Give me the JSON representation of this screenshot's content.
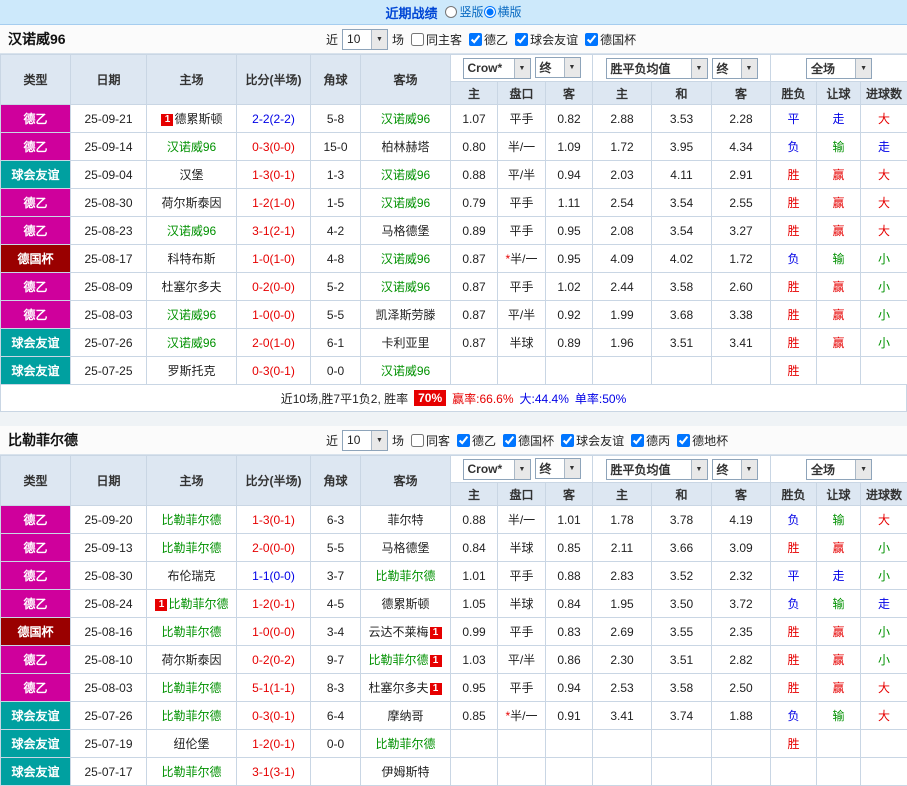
{
  "topbar": {
    "title": "近期战绩",
    "options": [
      {
        "label": "竖版",
        "selected": false
      },
      {
        "label": "横版",
        "selected": true
      }
    ]
  },
  "palette": {
    "league_colors": {
      "德乙": "#cf009c",
      "球会友谊": "#00a0a0",
      "德国杯": "#9a0000"
    },
    "result_colors": {
      "red": "#e60000",
      "blue": "#0000e6",
      "green": "#009100"
    },
    "score_colors": {
      "red": "#e60000",
      "blue": "#0000e6"
    },
    "team_highlight": "#009100"
  },
  "table_header": {
    "left": [
      "类型",
      "日期",
      "主场",
      "比分(半场)",
      "角球",
      "客场"
    ],
    "asia_select": "Crow*",
    "asia_final": "终",
    "asia_sub": [
      "主",
      "盘口",
      "客"
    ],
    "europe_select": "胜平负均值",
    "europe_final": "终",
    "europe_sub": [
      "主",
      "和",
      "客"
    ],
    "full_select": "全场",
    "result_sub": [
      "胜负",
      "让球",
      "进球数"
    ]
  },
  "sections": [
    {
      "team": "汉诺威96",
      "filter": {
        "prefix": "近",
        "count": "10",
        "suffix": "场",
        "checkboxes": [
          {
            "label": "同主客",
            "checked": false
          },
          {
            "label": "德乙",
            "checked": true
          },
          {
            "label": "球会友谊",
            "checked": true
          },
          {
            "label": "德国杯",
            "checked": true
          }
        ]
      },
      "rows": [
        {
          "league": "德乙",
          "date": "25-09-21",
          "home": "德累斯顿",
          "home_green": false,
          "home_badge": "1",
          "away": "汉诺威96",
          "away_green": true,
          "score": "2-2(2-2)",
          "score_color": "blue",
          "corner": "5-8",
          "asia": [
            "1.07",
            "平手",
            "0.82"
          ],
          "asia_star": false,
          "europe": [
            "2.88",
            "3.53",
            "2.28"
          ],
          "results": [
            [
              "平",
              "blue"
            ],
            [
              "走",
              "blue"
            ],
            [
              "大",
              "red"
            ]
          ]
        },
        {
          "league": "德乙",
          "date": "25-09-14",
          "home": "汉诺威96",
          "home_green": true,
          "away": "柏林赫塔",
          "away_green": false,
          "score": "0-3(0-0)",
          "score_color": "red",
          "corner": "15-0",
          "asia": [
            "0.80",
            "半/一",
            "1.09"
          ],
          "asia_star": false,
          "europe": [
            "1.72",
            "3.95",
            "4.34"
          ],
          "results": [
            [
              "负",
              "blue"
            ],
            [
              "输",
              "green"
            ],
            [
              "走",
              "blue"
            ]
          ]
        },
        {
          "league": "球会友谊",
          "date": "25-09-04",
          "home": "汉堡",
          "home_green": false,
          "away": "汉诺威96",
          "away_green": true,
          "score": "1-3(0-1)",
          "score_color": "red",
          "corner": "1-3",
          "asia": [
            "0.88",
            "平/半",
            "0.94"
          ],
          "asia_star": false,
          "europe": [
            "2.03",
            "4.11",
            "2.91"
          ],
          "results": [
            [
              "胜",
              "red"
            ],
            [
              "赢",
              "red"
            ],
            [
              "大",
              "red"
            ]
          ]
        },
        {
          "league": "德乙",
          "date": "25-08-30",
          "home": "荷尔斯泰因",
          "home_green": false,
          "away": "汉诺威96",
          "away_green": true,
          "score": "1-2(1-0)",
          "score_color": "red",
          "corner": "1-5",
          "asia": [
            "0.79",
            "平手",
            "1.11"
          ],
          "asia_star": false,
          "europe": [
            "2.54",
            "3.54",
            "2.55"
          ],
          "results": [
            [
              "胜",
              "red"
            ],
            [
              "赢",
              "red"
            ],
            [
              "大",
              "red"
            ]
          ]
        },
        {
          "league": "德乙",
          "date": "25-08-23",
          "home": "汉诺威96",
          "home_green": true,
          "away": "马格德堡",
          "away_green": false,
          "score": "3-1(2-1)",
          "score_color": "red",
          "corner": "4-2",
          "asia": [
            "0.89",
            "平手",
            "0.95"
          ],
          "asia_star": false,
          "europe": [
            "2.08",
            "3.54",
            "3.27"
          ],
          "results": [
            [
              "胜",
              "red"
            ],
            [
              "赢",
              "red"
            ],
            [
              "大",
              "red"
            ]
          ]
        },
        {
          "league": "德国杯",
          "date": "25-08-17",
          "home": "科特布斯",
          "home_green": false,
          "away": "汉诺威96",
          "away_green": true,
          "score": "1-0(1-0)",
          "score_color": "red",
          "corner": "4-8",
          "asia": [
            "0.87",
            "半/一",
            "0.95"
          ],
          "asia_star": true,
          "europe": [
            "4.09",
            "4.02",
            "1.72"
          ],
          "results": [
            [
              "负",
              "blue"
            ],
            [
              "输",
              "green"
            ],
            [
              "小",
              "green"
            ]
          ]
        },
        {
          "league": "德乙",
          "date": "25-08-09",
          "home": "杜塞尔多夫",
          "home_green": false,
          "away": "汉诺威96",
          "away_green": true,
          "score": "0-2(0-0)",
          "score_color": "red",
          "corner": "5-2",
          "asia": [
            "0.87",
            "平手",
            "1.02"
          ],
          "asia_star": false,
          "europe": [
            "2.44",
            "3.58",
            "2.60"
          ],
          "results": [
            [
              "胜",
              "red"
            ],
            [
              "赢",
              "red"
            ],
            [
              "小",
              "green"
            ]
          ]
        },
        {
          "league": "德乙",
          "date": "25-08-03",
          "home": "汉诺威96",
          "home_green": true,
          "away": "凯泽斯劳滕",
          "away_green": false,
          "score": "1-0(0-0)",
          "score_color": "red",
          "corner": "5-5",
          "asia": [
            "0.87",
            "平/半",
            "0.92"
          ],
          "asia_star": false,
          "europe": [
            "1.99",
            "3.68",
            "3.38"
          ],
          "results": [
            [
              "胜",
              "red"
            ],
            [
              "赢",
              "red"
            ],
            [
              "小",
              "green"
            ]
          ]
        },
        {
          "league": "球会友谊",
          "date": "25-07-26",
          "home": "汉诺威96",
          "home_green": true,
          "away": "卡利亚里",
          "away_green": false,
          "score": "2-0(1-0)",
          "score_color": "red",
          "corner": "6-1",
          "asia": [
            "0.87",
            "半球",
            "0.89"
          ],
          "asia_star": false,
          "europe": [
            "1.96",
            "3.51",
            "3.41"
          ],
          "results": [
            [
              "胜",
              "red"
            ],
            [
              "赢",
              "red"
            ],
            [
              "小",
              "green"
            ]
          ]
        },
        {
          "league": "球会友谊",
          "date": "25-07-25",
          "home": "罗斯托克",
          "home_green": false,
          "away": "汉诺威96",
          "away_green": true,
          "score": "0-3(0-1)",
          "score_color": "red",
          "corner": "0-0",
          "asia": [
            "",
            "",
            ""
          ],
          "asia_star": false,
          "europe": [
            "",
            "",
            ""
          ],
          "results": [
            [
              "胜",
              "red"
            ],
            [
              "",
              ""
            ],
            [
              "",
              ""
            ]
          ]
        }
      ],
      "summary": {
        "prefix": "近10场,胜7平1负2, 胜率",
        "rate": "70%",
        "stats": [
          {
            "text": "赢率:66.6%",
            "color": "red"
          },
          {
            "text": "大:44.4%",
            "color": "blue"
          },
          {
            "text": "单率:50%",
            "color": "blue"
          }
        ]
      }
    },
    {
      "team": "比勒菲尔德",
      "filter": {
        "prefix": "近",
        "count": "10",
        "suffix": "场",
        "checkboxes": [
          {
            "label": "同客",
            "checked": false
          },
          {
            "label": "德乙",
            "checked": true
          },
          {
            "label": "德国杯",
            "checked": true
          },
          {
            "label": "球会友谊",
            "checked": true
          },
          {
            "label": "德丙",
            "checked": true
          },
          {
            "label": "德地杯",
            "checked": true
          }
        ]
      },
      "rows": [
        {
          "league": "德乙",
          "date": "25-09-20",
          "home": "比勒菲尔德",
          "home_green": true,
          "away": "菲尔特",
          "away_green": false,
          "score": "1-3(0-1)",
          "score_color": "red",
          "corner": "6-3",
          "asia": [
            "0.88",
            "半/一",
            "1.01"
          ],
          "asia_star": false,
          "europe": [
            "1.78",
            "3.78",
            "4.19"
          ],
          "results": [
            [
              "负",
              "blue"
            ],
            [
              "输",
              "green"
            ],
            [
              "大",
              "red"
            ]
          ]
        },
        {
          "league": "德乙",
          "date": "25-09-13",
          "home": "比勒菲尔德",
          "home_green": true,
          "away": "马格德堡",
          "away_green": false,
          "score": "2-0(0-0)",
          "score_color": "red",
          "corner": "5-5",
          "asia": [
            "0.84",
            "半球",
            "0.85"
          ],
          "asia_star": false,
          "europe": [
            "2.11",
            "3.66",
            "3.09"
          ],
          "results": [
            [
              "胜",
              "red"
            ],
            [
              "赢",
              "red"
            ],
            [
              "小",
              "green"
            ]
          ]
        },
        {
          "league": "德乙",
          "date": "25-08-30",
          "home": "布伦瑞克",
          "home_green": false,
          "away": "比勒菲尔德",
          "away_green": true,
          "score": "1-1(0-0)",
          "score_color": "blue",
          "corner": "3-7",
          "asia": [
            "1.01",
            "平手",
            "0.88"
          ],
          "asia_star": false,
          "europe": [
            "2.83",
            "3.52",
            "2.32"
          ],
          "results": [
            [
              "平",
              "blue"
            ],
            [
              "走",
              "blue"
            ],
            [
              "小",
              "green"
            ]
          ]
        },
        {
          "league": "德乙",
          "date": "25-08-24",
          "home": "比勒菲尔德",
          "home_green": true,
          "home_badge": "1",
          "away": "德累斯顿",
          "away_green": false,
          "score": "1-2(0-1)",
          "score_color": "red",
          "corner": "4-5",
          "asia": [
            "1.05",
            "半球",
            "0.84"
          ],
          "asia_star": false,
          "europe": [
            "1.95",
            "3.50",
            "3.72"
          ],
          "results": [
            [
              "负",
              "blue"
            ],
            [
              "输",
              "green"
            ],
            [
              "走",
              "blue"
            ]
          ]
        },
        {
          "league": "德国杯",
          "date": "25-08-16",
          "home": "比勒菲尔德",
          "home_green": true,
          "away": "云达不莱梅",
          "away_green": false,
          "away_badge": "1",
          "score": "1-0(0-0)",
          "score_color": "red",
          "corner": "3-4",
          "asia": [
            "0.99",
            "平手",
            "0.83"
          ],
          "asia_star": false,
          "europe": [
            "2.69",
            "3.55",
            "2.35"
          ],
          "results": [
            [
              "胜",
              "red"
            ],
            [
              "赢",
              "red"
            ],
            [
              "小",
              "green"
            ]
          ]
        },
        {
          "league": "德乙",
          "date": "25-08-10",
          "home": "荷尔斯泰因",
          "home_green": false,
          "away": "比勒菲尔德",
          "away_green": true,
          "away_badge": "1",
          "score": "0-2(0-2)",
          "score_color": "red",
          "corner": "9-7",
          "asia": [
            "1.03",
            "平/半",
            "0.86"
          ],
          "asia_star": false,
          "europe": [
            "2.30",
            "3.51",
            "2.82"
          ],
          "results": [
            [
              "胜",
              "red"
            ],
            [
              "赢",
              "red"
            ],
            [
              "小",
              "green"
            ]
          ]
        },
        {
          "league": "德乙",
          "date": "25-08-03",
          "home": "比勒菲尔德",
          "home_green": true,
          "away": "杜塞尔多夫",
          "away_green": false,
          "away_badge": "1",
          "score": "5-1(1-1)",
          "score_color": "red",
          "corner": "8-3",
          "asia": [
            "0.95",
            "平手",
            "0.94"
          ],
          "asia_star": false,
          "europe": [
            "2.53",
            "3.58",
            "2.50"
          ],
          "results": [
            [
              "胜",
              "red"
            ],
            [
              "赢",
              "red"
            ],
            [
              "大",
              "red"
            ]
          ]
        },
        {
          "league": "球会友谊",
          "date": "25-07-26",
          "home": "比勒菲尔德",
          "home_green": true,
          "away": "摩纳哥",
          "away_green": false,
          "score": "0-3(0-1)",
          "score_color": "red",
          "corner": "6-4",
          "asia": [
            "0.85",
            "半/一",
            "0.91"
          ],
          "asia_star": true,
          "europe": [
            "3.41",
            "3.74",
            "1.88"
          ],
          "results": [
            [
              "负",
              "blue"
            ],
            [
              "输",
              "green"
            ],
            [
              "大",
              "red"
            ]
          ]
        },
        {
          "league": "球会友谊",
          "date": "25-07-19",
          "home": "纽伦堡",
          "home_green": false,
          "away": "比勒菲尔德",
          "away_green": true,
          "score": "1-2(0-1)",
          "score_color": "red",
          "corner": "0-0",
          "asia": [
            "",
            "",
            ""
          ],
          "asia_star": false,
          "europe": [
            "",
            "",
            ""
          ],
          "results": [
            [
              "胜",
              "red"
            ],
            [
              "",
              ""
            ],
            [
              "",
              ""
            ]
          ]
        },
        {
          "league": "球会友谊",
          "date": "25-07-17",
          "home": "比勒菲尔德",
          "home_green": true,
          "away": "伊姆斯特",
          "away_green": false,
          "score": "3-1(3-1)",
          "score_color": "red",
          "corner": "",
          "asia": [
            "",
            "",
            ""
          ],
          "asia_star": false,
          "europe": [
            "",
            "",
            ""
          ],
          "results": [
            [
              "",
              ""
            ],
            [
              "",
              ""
            ],
            [
              "",
              ""
            ]
          ]
        }
      ],
      "summary": null
    }
  ]
}
